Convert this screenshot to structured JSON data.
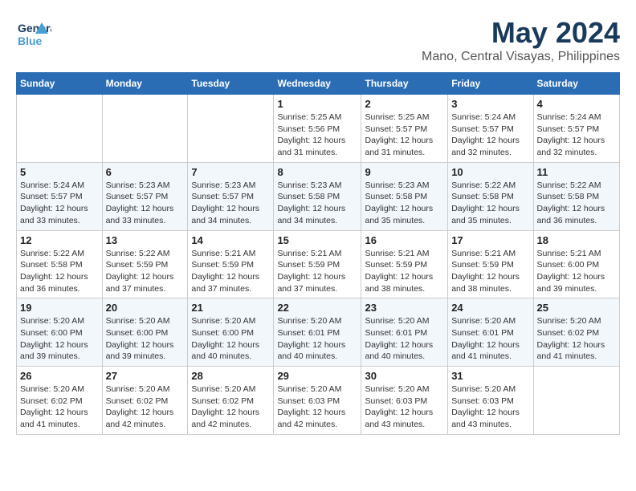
{
  "header": {
    "logo": {
      "line1": "General",
      "line2": "Blue"
    },
    "title": "May 2024",
    "subtitle": "Mano, Central Visayas, Philippines"
  },
  "weekdays": [
    "Sunday",
    "Monday",
    "Tuesday",
    "Wednesday",
    "Thursday",
    "Friday",
    "Saturday"
  ],
  "weeks": [
    [
      {
        "day": "",
        "info": ""
      },
      {
        "day": "",
        "info": ""
      },
      {
        "day": "",
        "info": ""
      },
      {
        "day": "1",
        "info": "Sunrise: 5:25 AM\nSunset: 5:56 PM\nDaylight: 12 hours\nand 31 minutes."
      },
      {
        "day": "2",
        "info": "Sunrise: 5:25 AM\nSunset: 5:57 PM\nDaylight: 12 hours\nand 31 minutes."
      },
      {
        "day": "3",
        "info": "Sunrise: 5:24 AM\nSunset: 5:57 PM\nDaylight: 12 hours\nand 32 minutes."
      },
      {
        "day": "4",
        "info": "Sunrise: 5:24 AM\nSunset: 5:57 PM\nDaylight: 12 hours\nand 32 minutes."
      }
    ],
    [
      {
        "day": "5",
        "info": "Sunrise: 5:24 AM\nSunset: 5:57 PM\nDaylight: 12 hours\nand 33 minutes."
      },
      {
        "day": "6",
        "info": "Sunrise: 5:23 AM\nSunset: 5:57 PM\nDaylight: 12 hours\nand 33 minutes."
      },
      {
        "day": "7",
        "info": "Sunrise: 5:23 AM\nSunset: 5:57 PM\nDaylight: 12 hours\nand 34 minutes."
      },
      {
        "day": "8",
        "info": "Sunrise: 5:23 AM\nSunset: 5:58 PM\nDaylight: 12 hours\nand 34 minutes."
      },
      {
        "day": "9",
        "info": "Sunrise: 5:23 AM\nSunset: 5:58 PM\nDaylight: 12 hours\nand 35 minutes."
      },
      {
        "day": "10",
        "info": "Sunrise: 5:22 AM\nSunset: 5:58 PM\nDaylight: 12 hours\nand 35 minutes."
      },
      {
        "day": "11",
        "info": "Sunrise: 5:22 AM\nSunset: 5:58 PM\nDaylight: 12 hours\nand 36 minutes."
      }
    ],
    [
      {
        "day": "12",
        "info": "Sunrise: 5:22 AM\nSunset: 5:58 PM\nDaylight: 12 hours\nand 36 minutes."
      },
      {
        "day": "13",
        "info": "Sunrise: 5:22 AM\nSunset: 5:59 PM\nDaylight: 12 hours\nand 37 minutes."
      },
      {
        "day": "14",
        "info": "Sunrise: 5:21 AM\nSunset: 5:59 PM\nDaylight: 12 hours\nand 37 minutes."
      },
      {
        "day": "15",
        "info": "Sunrise: 5:21 AM\nSunset: 5:59 PM\nDaylight: 12 hours\nand 37 minutes."
      },
      {
        "day": "16",
        "info": "Sunrise: 5:21 AM\nSunset: 5:59 PM\nDaylight: 12 hours\nand 38 minutes."
      },
      {
        "day": "17",
        "info": "Sunrise: 5:21 AM\nSunset: 5:59 PM\nDaylight: 12 hours\nand 38 minutes."
      },
      {
        "day": "18",
        "info": "Sunrise: 5:21 AM\nSunset: 6:00 PM\nDaylight: 12 hours\nand 39 minutes."
      }
    ],
    [
      {
        "day": "19",
        "info": "Sunrise: 5:20 AM\nSunset: 6:00 PM\nDaylight: 12 hours\nand 39 minutes."
      },
      {
        "day": "20",
        "info": "Sunrise: 5:20 AM\nSunset: 6:00 PM\nDaylight: 12 hours\nand 39 minutes."
      },
      {
        "day": "21",
        "info": "Sunrise: 5:20 AM\nSunset: 6:00 PM\nDaylight: 12 hours\nand 40 minutes."
      },
      {
        "day": "22",
        "info": "Sunrise: 5:20 AM\nSunset: 6:01 PM\nDaylight: 12 hours\nand 40 minutes."
      },
      {
        "day": "23",
        "info": "Sunrise: 5:20 AM\nSunset: 6:01 PM\nDaylight: 12 hours\nand 40 minutes."
      },
      {
        "day": "24",
        "info": "Sunrise: 5:20 AM\nSunset: 6:01 PM\nDaylight: 12 hours\nand 41 minutes."
      },
      {
        "day": "25",
        "info": "Sunrise: 5:20 AM\nSunset: 6:02 PM\nDaylight: 12 hours\nand 41 minutes."
      }
    ],
    [
      {
        "day": "26",
        "info": "Sunrise: 5:20 AM\nSunset: 6:02 PM\nDaylight: 12 hours\nand 41 minutes."
      },
      {
        "day": "27",
        "info": "Sunrise: 5:20 AM\nSunset: 6:02 PM\nDaylight: 12 hours\nand 42 minutes."
      },
      {
        "day": "28",
        "info": "Sunrise: 5:20 AM\nSunset: 6:02 PM\nDaylight: 12 hours\nand 42 minutes."
      },
      {
        "day": "29",
        "info": "Sunrise: 5:20 AM\nSunset: 6:03 PM\nDaylight: 12 hours\nand 42 minutes."
      },
      {
        "day": "30",
        "info": "Sunrise: 5:20 AM\nSunset: 6:03 PM\nDaylight: 12 hours\nand 43 minutes."
      },
      {
        "day": "31",
        "info": "Sunrise: 5:20 AM\nSunset: 6:03 PM\nDaylight: 12 hours\nand 43 minutes."
      },
      {
        "day": "",
        "info": ""
      }
    ]
  ]
}
